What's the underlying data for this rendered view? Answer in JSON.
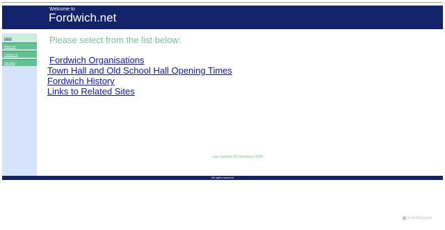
{
  "header": {
    "welcome": "Welcome to",
    "title": "Fordwich.net"
  },
  "sidebar": {
    "items": [
      {
        "label": "Home"
      },
      {
        "label": "About Us"
      },
      {
        "label": "Contact Us"
      },
      {
        "label": "Site Map"
      }
    ]
  },
  "main": {
    "prompt": "Please select from the list below:",
    "links": [
      {
        "label": "Fordwich Organisations"
      },
      {
        "label": "Town Hall and Old School Hall Opening Times"
      },
      {
        "label": "Fordwich History"
      },
      {
        "label": "Links to Related Sites"
      }
    ],
    "last_updated": "Last updated 06 December 2008"
  },
  "footer": {
    "text": "All rights reserved"
  },
  "watermark": {
    "text": "ScanMalware",
    "icon": "shield-icon"
  },
  "colors": {
    "header_bg": "#12236b",
    "sidebar_bg": "#d6e3fb",
    "nav_green": "#62c28f",
    "prompt_green": "#74c58e",
    "link_blue": "#0b12c8"
  }
}
